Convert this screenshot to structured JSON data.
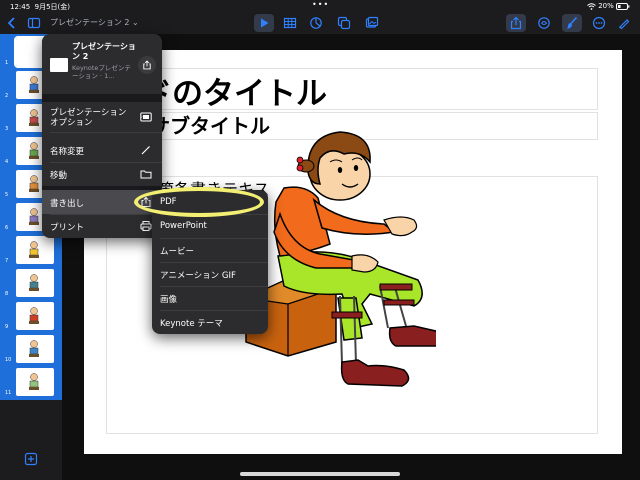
{
  "status_bar": {
    "time": "12:45",
    "date": "9月5日(金)",
    "dots": "•••",
    "battery": "20%"
  },
  "toolbar": {
    "document_title": "プレゼンテーション 2 ⌄",
    "accent_color": "#2f80ff"
  },
  "thumbnails": {
    "numbers": [
      "1",
      "2",
      "3",
      "4",
      "5",
      "6",
      "7",
      "8",
      "9",
      "10",
      "11"
    ]
  },
  "slide": {
    "title": "イドのタイトル",
    "subtitle": "ドのサブタイトル",
    "body": "イドの箇条書きテキス"
  },
  "popover": {
    "doc_title": "プレゼンテーション 2",
    "doc_subtitle": "Keynoteプレゼンテーション · 1...",
    "items": [
      {
        "label": "プレゼンテーション\nオプション",
        "icon": "slides-icon"
      },
      {
        "label": "名称変更",
        "icon": "pencil-icon"
      },
      {
        "label": "移動",
        "icon": "folder-icon"
      },
      {
        "label": "書き出し",
        "icon": "export-icon"
      },
      {
        "label": "プリント",
        "icon": "printer-icon"
      }
    ]
  },
  "export_submenu": {
    "items": [
      "PDF",
      "PowerPoint",
      "ムービー",
      "アニメーション GIF",
      "画像",
      "Keynote テーマ"
    ]
  }
}
